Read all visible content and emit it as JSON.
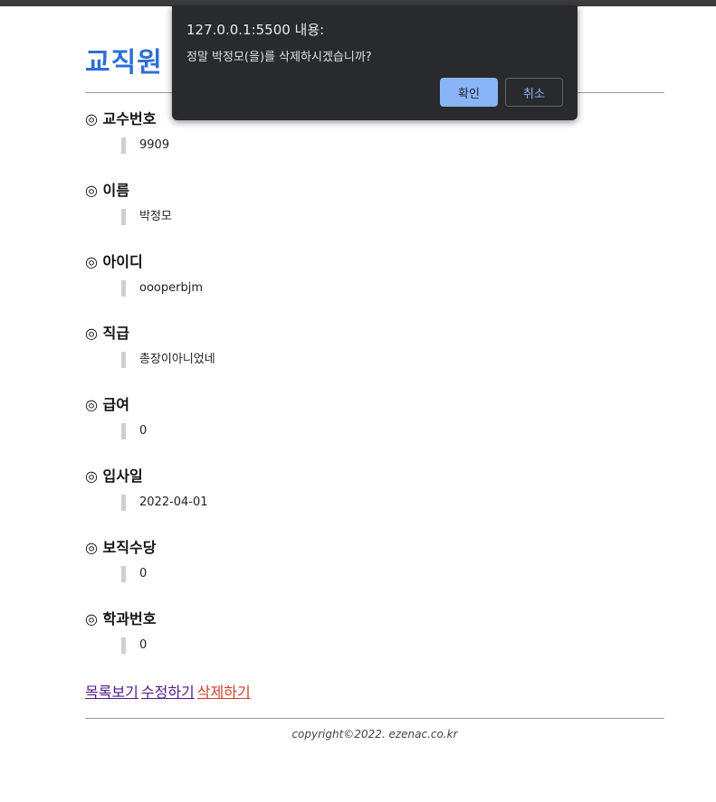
{
  "page": {
    "title": "교직원",
    "fields": [
      {
        "label": "◎ 교수번호",
        "value": "9909"
      },
      {
        "label": "◎ 이름",
        "value": "박정모"
      },
      {
        "label": "◎ 아이디",
        "value": "oooperbjm"
      },
      {
        "label": "◎ 직급",
        "value": "총장이아니었네"
      },
      {
        "label": "◎ 급여",
        "value": "0"
      },
      {
        "label": "◎ 입사일",
        "value": "2022-04-01"
      },
      {
        "label": "◎ 보직수당",
        "value": "0"
      },
      {
        "label": "◎ 학과번호",
        "value": "0"
      }
    ],
    "links": {
      "list": "목록보기",
      "edit": "수정하기",
      "delete": "삭제하기"
    },
    "footer": "copyright©2022. ezenac.co.kr"
  },
  "dialog": {
    "title": "127.0.0.1:5500 내용:",
    "message": "정말 박정모(을)를 삭제하시겠습니까?",
    "ok_label": "확인",
    "cancel_label": "취소"
  },
  "colors": {
    "title": "#2e6fd8",
    "visited_link": "#551a8b",
    "delete_link": "#d33b2c",
    "dialog_bg": "#292a2d",
    "dialog_ok": "#8ab4f8"
  }
}
